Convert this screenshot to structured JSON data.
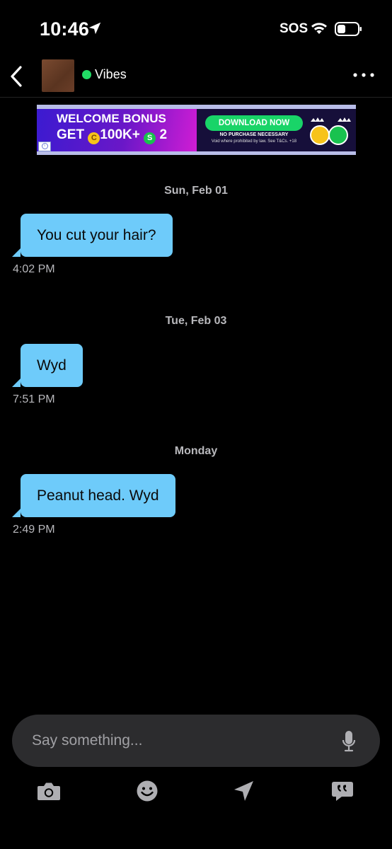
{
  "status_bar": {
    "time": "10:46",
    "carrier_status": "SOS"
  },
  "nav": {
    "contact_name": "Vibes",
    "online_color": "#22dd66"
  },
  "ad": {
    "headline_line1": "WELCOME BONUS",
    "headline_line2_prefix": "GET",
    "gold_coin_amount": "100K+",
    "green_coin_amount": "2",
    "gold_coin_letter": "C",
    "green_coin_letter": "S",
    "cta": "DOWNLOAD NOW",
    "disclaimer1": "NO PURCHASE NECESSARY",
    "disclaimer2": "Void where prohibited by law. See T&Cs. +18",
    "info_glyph": "i"
  },
  "conversation": [
    {
      "date": "Sun, Feb 01",
      "text": "You cut your hair?",
      "time": "4:02 PM"
    },
    {
      "date": "Tue, Feb 03",
      "text": "Wyd",
      "time": "7:51 PM"
    },
    {
      "date": "Monday",
      "text": "Peanut head. Wyd",
      "time": "2:49 PM"
    }
  ],
  "composer": {
    "placeholder": "Say something..."
  },
  "toolbar": {
    "icons": [
      "camera-icon",
      "emoji-icon",
      "location-arrow-icon",
      "quote-bubble-icon"
    ]
  },
  "colors": {
    "bubble": "#6ecbfa",
    "background": "#000000",
    "composer": "#2c2c2e",
    "cta": "#19d468"
  }
}
